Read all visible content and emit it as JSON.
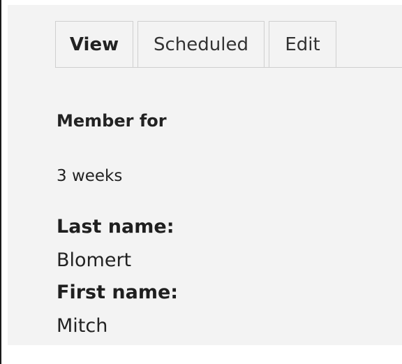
{
  "tabs": [
    {
      "label": "View",
      "active": true
    },
    {
      "label": "Scheduled",
      "active": false
    },
    {
      "label": "Edit",
      "active": false
    }
  ],
  "member": {
    "label": "Member for",
    "value": "3 weeks"
  },
  "fields": {
    "last_name": {
      "label": "Last name:",
      "value": "Blomert"
    },
    "first_name": {
      "label": "First name:",
      "value": "Mitch"
    }
  },
  "colors": {
    "background": "#f3f3f3",
    "page": "#ffffff",
    "border": "#cfcfcf",
    "text": "#222222"
  }
}
